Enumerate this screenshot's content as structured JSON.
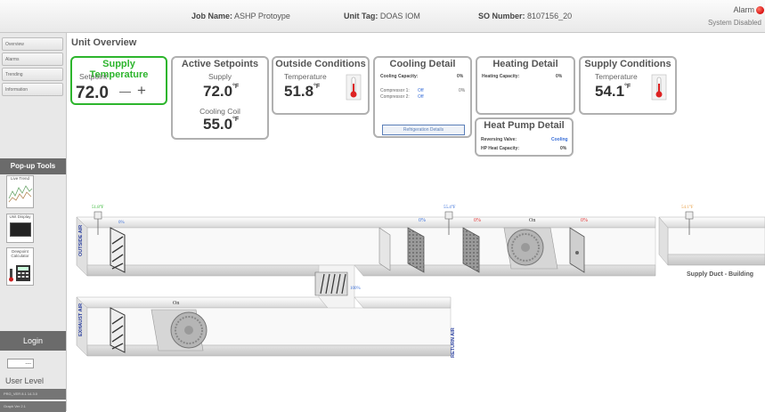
{
  "header": {
    "job_label": "Job Name:",
    "job_value": "ASHP Protoype",
    "unit_label": "Unit Tag:",
    "unit_value": "DOAS IOM",
    "so_label": "SO Number:",
    "so_value": "8107156_20",
    "alarm": "Alarm",
    "system_status": "System Disabled"
  },
  "sidebar": {
    "nav": [
      "Overview",
      "Alarms",
      "Trending",
      "Information"
    ],
    "popup_title": "Pop-up Tools",
    "tools": [
      "Live Trend",
      "Unit Display",
      "Dewpoint Calculator"
    ],
    "login": "Login",
    "level_value": "----",
    "user_level": "User Level",
    "version_1": "PRG_VER 8.1 14.3.0",
    "version_2": "Graph Ver 2.1"
  },
  "main": {
    "title": "Unit Overview",
    "supply_temp": {
      "title": "Supply Temperature",
      "label": "Setpoint",
      "value": "72.0",
      "minus": "—",
      "plus": "+"
    },
    "active_setpoints": {
      "title": "Active Setpoints",
      "supply_label": "Supply",
      "supply_value": "72.0",
      "unit": "°F",
      "coil_label": "Cooling Coil",
      "coil_value": "55.0"
    },
    "outside": {
      "title": "Outside Conditions",
      "label": "Temperature",
      "value": "51.8",
      "unit": "°F"
    },
    "cooling": {
      "title": "Cooling Detail",
      "capacity_label": "Cooling Capacity:",
      "capacity_value": "0%",
      "comp1_label": "Compressor 1:",
      "comp1_state": "Off",
      "comp1_pct": "0%",
      "comp2_label": "Compressor 2:",
      "comp2_state": "Off",
      "button": "Refrigeration Details"
    },
    "heating": {
      "title": "Heating Detail",
      "capacity_label": "Heating Capacity:",
      "capacity_value": "0%"
    },
    "heatpump": {
      "title": "Heat Pump Detail",
      "rv_label": "Reversing Valve:",
      "rv_value": "Cooling",
      "hp_label": "HP Heat Capacity:",
      "hp_value": "0%"
    },
    "supply_cond": {
      "title": "Supply Conditions",
      "label": "Temperature",
      "value": "54.1",
      "unit": "°F"
    }
  },
  "diagram": {
    "outside_air": "OUTSIDE AIR",
    "exhaust_air": "EXHAUST AIR",
    "return_air": "RETURN AIR",
    "supply_duct": "Supply Duct - Building",
    "oa_temp": "51.8°F",
    "oa_damper": "0%",
    "mixed_temp": "55.4°F",
    "filter_pct": "0%",
    "coil_pct": "0%",
    "fan_state": "On",
    "heat_pct": "0%",
    "supply_temp": "54.1°F",
    "recirc_pct": "100%",
    "exhaust_fan_state": "On"
  },
  "colors": {
    "sp_green": "#2db52d",
    "alarm_red": "#d90f0f",
    "blue_text": "#3a6fd8",
    "red_text": "#e03030",
    "orange_text": "#e8a24a"
  }
}
